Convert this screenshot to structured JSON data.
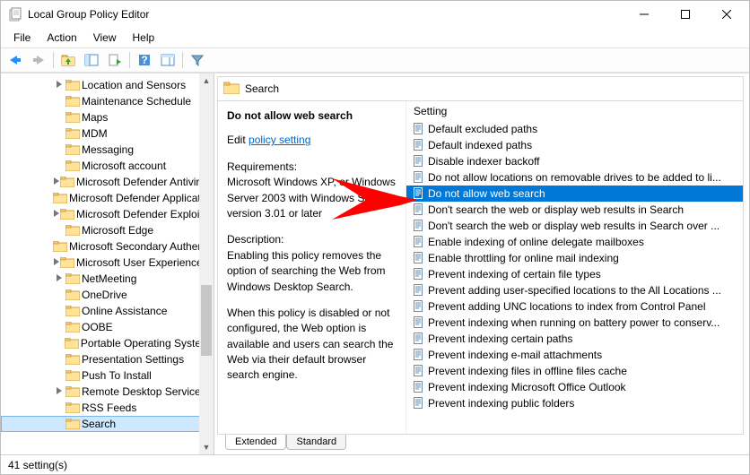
{
  "window": {
    "title": "Local Group Policy Editor"
  },
  "menu": {
    "file": "File",
    "action": "Action",
    "view": "View",
    "help": "Help"
  },
  "tree": {
    "items": [
      {
        "label": "Location and Sensors",
        "expandable": true,
        "indent": 72
      },
      {
        "label": "Maintenance Schedule",
        "expandable": false,
        "indent": 72
      },
      {
        "label": "Maps",
        "expandable": false,
        "indent": 72
      },
      {
        "label": "MDM",
        "expandable": false,
        "indent": 72
      },
      {
        "label": "Messaging",
        "expandable": false,
        "indent": 72
      },
      {
        "label": "Microsoft account",
        "expandable": false,
        "indent": 72
      },
      {
        "label": "Microsoft Defender Antivirus",
        "expandable": true,
        "indent": 72
      },
      {
        "label": "Microsoft Defender Application Guard",
        "expandable": false,
        "indent": 72
      },
      {
        "label": "Microsoft Defender Exploit Guard",
        "expandable": true,
        "indent": 72
      },
      {
        "label": "Microsoft Edge",
        "expandable": false,
        "indent": 72
      },
      {
        "label": "Microsoft Secondary Authentication Factor",
        "expandable": false,
        "indent": 72
      },
      {
        "label": "Microsoft User Experience Virtualization",
        "expandable": true,
        "indent": 72
      },
      {
        "label": "NetMeeting",
        "expandable": true,
        "indent": 72
      },
      {
        "label": "OneDrive",
        "expandable": false,
        "indent": 72
      },
      {
        "label": "Online Assistance",
        "expandable": false,
        "indent": 72
      },
      {
        "label": "OOBE",
        "expandable": false,
        "indent": 72
      },
      {
        "label": "Portable Operating System",
        "expandable": false,
        "indent": 72
      },
      {
        "label": "Presentation Settings",
        "expandable": false,
        "indent": 72
      },
      {
        "label": "Push To Install",
        "expandable": false,
        "indent": 72
      },
      {
        "label": "Remote Desktop Services",
        "expandable": true,
        "indent": 72
      },
      {
        "label": "RSS Feeds",
        "expandable": false,
        "indent": 72
      },
      {
        "label": "Search",
        "expandable": false,
        "indent": 72,
        "selected": true
      }
    ]
  },
  "section": {
    "title": "Search"
  },
  "detail": {
    "name": "Do not allow web search",
    "edit_prefix": "Edit",
    "edit_link": "policy setting ",
    "requirements_label": "Requirements:",
    "requirements_text": "Microsoft Windows XP, or Windows Server 2003 with Windows Search version 3.01 or later",
    "description_label": "Description:",
    "description_text1": "Enabling this policy removes the option of searching the Web from Windows Desktop Search.",
    "description_text2": "When this policy is disabled or not configured, the Web option is available and users can search the Web via their default browser search engine."
  },
  "settings": {
    "column_header": "Setting",
    "items": [
      {
        "label": "Default excluded paths"
      },
      {
        "label": "Default indexed paths"
      },
      {
        "label": "Disable indexer backoff"
      },
      {
        "label": "Do not allow locations on removable drives to be added to li..."
      },
      {
        "label": "Do not allow web search",
        "selected": true
      },
      {
        "label": "Don't search the web or display web results in Search"
      },
      {
        "label": "Don't search the web or display web results in Search over ..."
      },
      {
        "label": "Enable indexing of online delegate mailboxes"
      },
      {
        "label": "Enable throttling for online mail indexing"
      },
      {
        "label": "Prevent indexing of certain file types"
      },
      {
        "label": "Prevent adding user-specified locations to the All Locations ..."
      },
      {
        "label": "Prevent adding UNC locations to index from Control Panel"
      },
      {
        "label": "Prevent indexing when running on battery power to conserv..."
      },
      {
        "label": "Prevent indexing certain paths"
      },
      {
        "label": "Prevent indexing e-mail attachments"
      },
      {
        "label": "Prevent indexing files in offline files cache"
      },
      {
        "label": "Prevent indexing Microsoft Office Outlook"
      },
      {
        "label": "Prevent indexing public folders"
      }
    ]
  },
  "tabs": {
    "extended": "Extended",
    "standard": "Standard"
  },
  "status": {
    "text": "41 setting(s)"
  }
}
